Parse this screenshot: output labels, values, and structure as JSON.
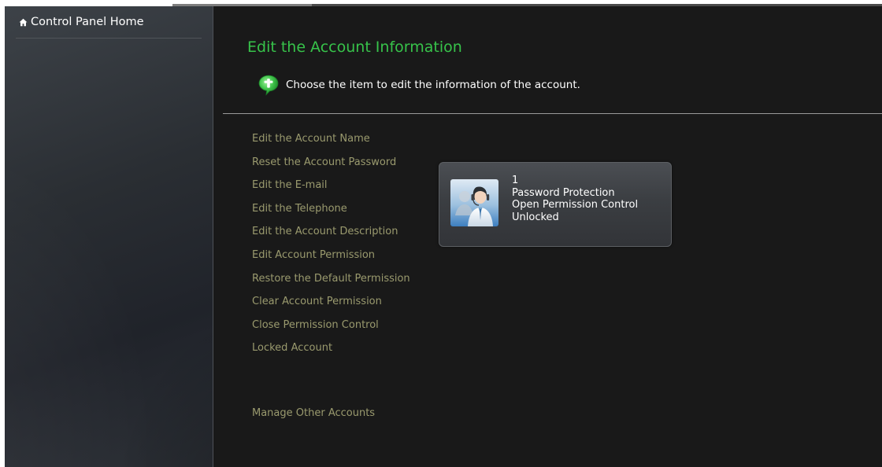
{
  "sidebar": {
    "home_label": "Control Panel Home"
  },
  "main": {
    "title": "Edit the Account Information",
    "tip": "Choose the item to edit the information of the account.",
    "actions": [
      "Edit the Account Name",
      "Reset the Account Password",
      "Edit the E-mail",
      "Edit the Telephone",
      "Edit the Account Description",
      "Edit Account Permission",
      "Restore the Default Permission",
      "Clear Account Permission",
      "Close Permission Control",
      "Locked Account"
    ],
    "manage_other": "Manage Other Accounts"
  },
  "account": {
    "name": "1",
    "lines": [
      "Password Protection",
      "Open Permission Control",
      "Unlocked"
    ]
  },
  "colors": {
    "title_green": "#37c34a",
    "link_olive": "#9a9a6e",
    "background": "#191919",
    "text_white": "#ffffff"
  },
  "icons": {
    "home": "home-icon",
    "tip": "info-bubble-icon",
    "avatar": "user-avatar-icon"
  }
}
